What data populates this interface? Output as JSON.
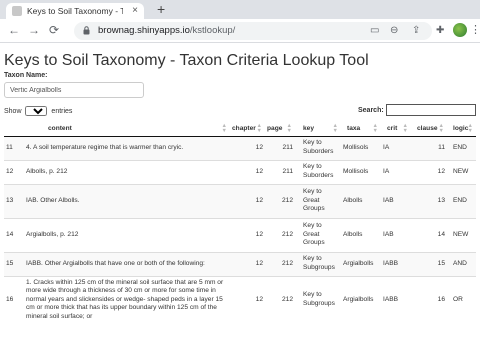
{
  "browser": {
    "tab_title": "Keys to Soil Taxonomy - Taxon C",
    "tab_close": "×",
    "new_tab": "+",
    "url_host": "brownag.shinyapps.io",
    "url_path": "/kstlookup/",
    "back": "←",
    "forward": "→",
    "reload": "⟳",
    "menu": "⋮"
  },
  "page": {
    "title": "Keys to Soil Taxonomy - Taxon Criteria Lookup Tool",
    "taxon_label": "Taxon Name:",
    "taxon_value": "Vertic Argialbolls",
    "show_label": "Show",
    "entries_label": "entries",
    "entries_selected": "10",
    "search_label": "Search:"
  },
  "table": {
    "columns": [
      "",
      "content",
      "chapter",
      "page",
      "key",
      "taxa",
      "crit",
      "clause",
      "logic"
    ],
    "rows": [
      {
        "id": "11",
        "content": "4. A soil temperature regime that is warmer than cryic.",
        "chapter": "12",
        "page": "211",
        "key": "Key to Suborders",
        "taxa": "Mollisols",
        "crit": "IA",
        "clause": "11",
        "logic": "END"
      },
      {
        "id": "12",
        "content": "Albolls, p. 212",
        "chapter": "12",
        "page": "211",
        "key": "Key to Suborders",
        "taxa": "Mollisols",
        "crit": "IA",
        "clause": "12",
        "logic": "NEW"
      },
      {
        "id": "13",
        "content": "IAB. Other Albolls.",
        "chapter": "12",
        "page": "212",
        "key": "Key to Great Groups",
        "taxa": "Albolls",
        "crit": "IAB",
        "clause": "13",
        "logic": "END"
      },
      {
        "id": "14",
        "content": "Argialbolls, p. 212",
        "chapter": "12",
        "page": "212",
        "key": "Key to Great Groups",
        "taxa": "Albolls",
        "crit": "IAB",
        "clause": "14",
        "logic": "NEW"
      },
      {
        "id": "15",
        "content": "IABB. Other Argialbolls that have one or both of the following:",
        "chapter": "12",
        "page": "212",
        "key": "Key to Subgroups",
        "taxa": "Argialbolls",
        "crit": "IABB",
        "clause": "15",
        "logic": "AND"
      },
      {
        "id": "16",
        "content": "1. Cracks within 125 cm of the mineral soil surface that are 5 mm or more wide through a thickness of 30 cm or more for some time in normal years and slickensides or wedge- shaped peds in a layer 15 cm or more thick that has its upper boundary within 125 cm of the mineral soil surface; or",
        "chapter": "12",
        "page": "212",
        "key": "Key to Subgroups",
        "taxa": "Argialbolls",
        "crit": "IABB",
        "clause": "16",
        "logic": "OR"
      }
    ]
  }
}
